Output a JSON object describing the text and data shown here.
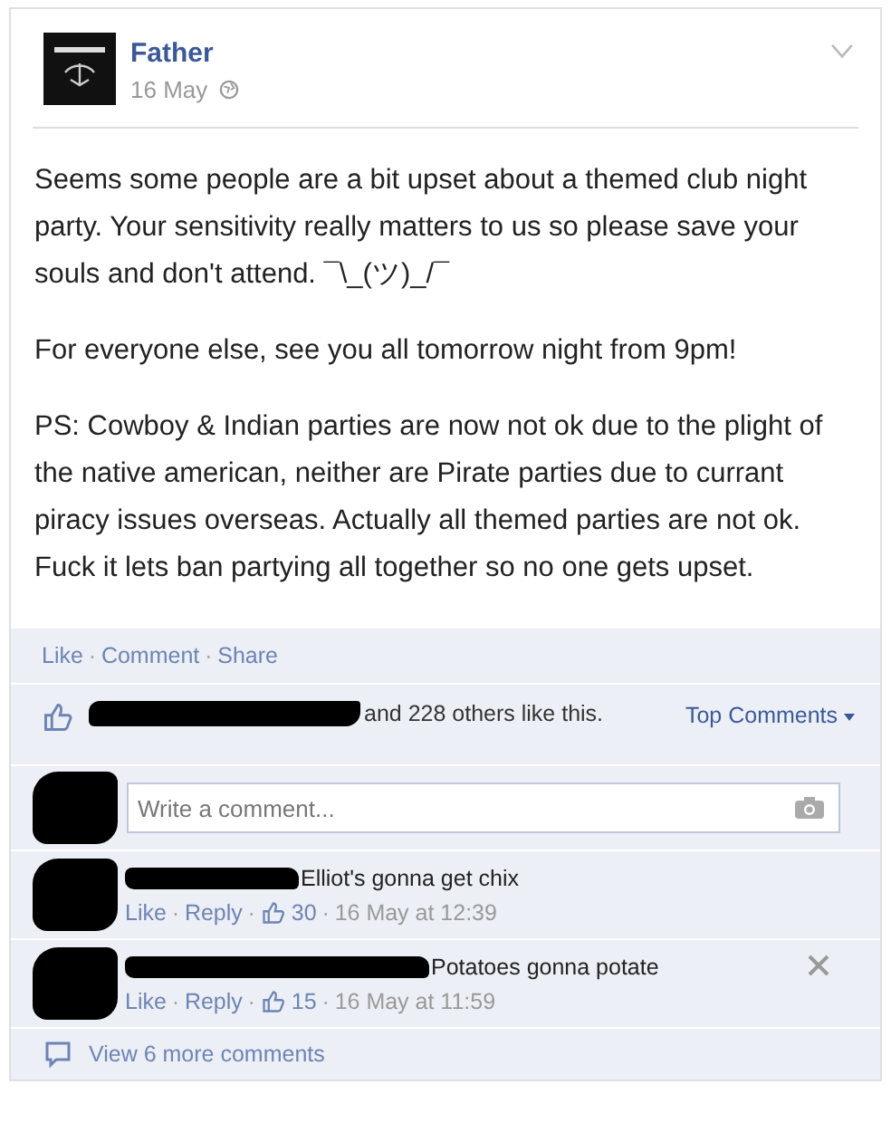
{
  "post": {
    "author": "Father",
    "date": "16 May",
    "paragraphs": [
      "Seems some people are a bit upset about a themed club night party. Your sensitivity really matters to us so please save your souls and don't attend. ¯\\_(ツ)_/¯",
      "For everyone else, see you all tomorrow night from 9pm!",
      "PS: Cowboy & Indian parties are now not ok due to the plight of the native american, neither are Pirate parties due to currant piracy issues overseas. Actually all themed parties are not ok. Fuck it lets ban partying all together so no one gets upset."
    ]
  },
  "separator": "·",
  "actions": [
    "Like",
    "Comment",
    "Share"
  ],
  "likes": {
    "text": "and 228 others like this.",
    "sort": "Top Comments"
  },
  "comment_input": {
    "placeholder": "Write a comment..."
  },
  "comments": [
    {
      "text": "Elliot's gonna get chix",
      "actions": [
        "Like",
        "Reply"
      ],
      "likes": "30",
      "time": "16 May at 12:39",
      "removable": false
    },
    {
      "text": "Potatoes gonna potate",
      "actions": [
        "Like",
        "Reply"
      ],
      "likes": "15",
      "time": "16 May at 11:59",
      "removable": true
    }
  ],
  "view_more": "View 6 more comments"
}
